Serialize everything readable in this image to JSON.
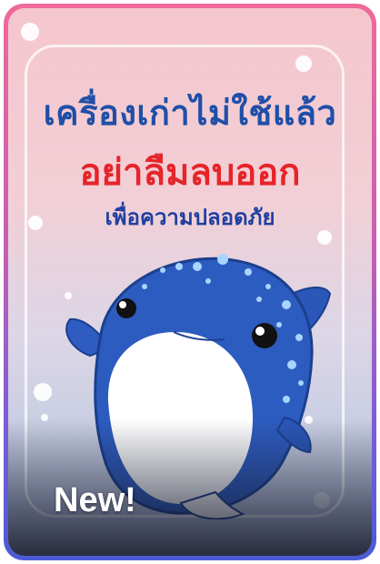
{
  "poster": {
    "title_line1": "เครื่องเก่าไม่ใช้แล้ว",
    "title_line2": "อย่าลืมลบออก",
    "title_line3": "เพื่อความปลอดภัย",
    "badge": "New!"
  },
  "mascot": {
    "name_icon": "whale-shark-mascot-icon"
  },
  "colors": {
    "title_blue": "#1f4fa8",
    "title_red": "#e5252a",
    "border_top": "#f0699a",
    "border_bottom": "#4a5bd6"
  }
}
